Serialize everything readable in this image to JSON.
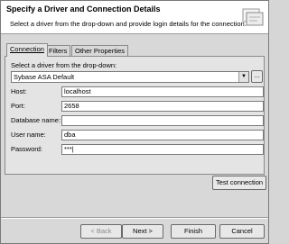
{
  "header": {
    "title": "Specify a Driver and Connection Details",
    "description": "Select a driver from the drop-down and provide login details for the connection.",
    "icon": "database-connection-icon"
  },
  "tabs": [
    {
      "label": "Connection",
      "active": true
    },
    {
      "label": "Filters",
      "active": false
    },
    {
      "label": "Other Properties",
      "active": false
    }
  ],
  "driver": {
    "label": "Select a driver from the drop-down:",
    "selected": "Sybase ASA Default",
    "browse_label": "..."
  },
  "fields": {
    "host": {
      "label": "Host:",
      "value": "localhost"
    },
    "port": {
      "label": "Port:",
      "value": "2658"
    },
    "database": {
      "label": "Database name:",
      "value": ""
    },
    "user": {
      "label": "User name:",
      "value": "dba"
    },
    "password": {
      "label": "Password:",
      "value": "***|"
    }
  },
  "buttons": {
    "test_connection": "Test connection",
    "back": "< Back",
    "next": "Next >",
    "finish": "Finish",
    "cancel": "Cancel"
  }
}
